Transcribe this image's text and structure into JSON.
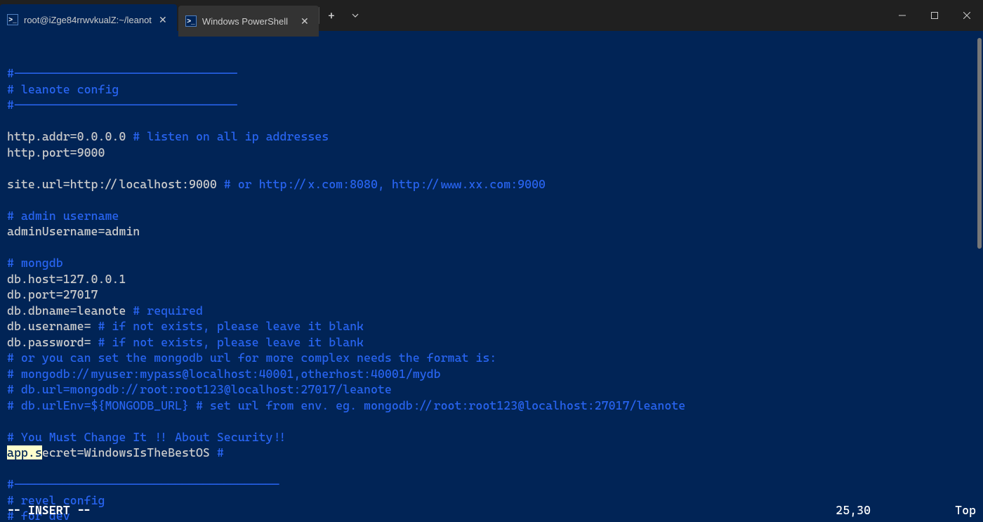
{
  "tabs": [
    {
      "title": "root@iZge84rrwvkualZ:~/leanot",
      "active": true
    },
    {
      "title": "Windows PowerShell",
      "active": false
    }
  ],
  "icons": {
    "ps": ">_",
    "close": "✕",
    "plus": "+",
    "chevron_down": "⌄",
    "minimize": "—",
    "maximize": "▢",
    "window_close": "✕"
  },
  "editor": {
    "lines": [
      {
        "segments": [
          {
            "t": "#--------------------------------",
            "c": "comment"
          }
        ]
      },
      {
        "segments": [
          {
            "t": "# leanote config",
            "c": "comment"
          }
        ]
      },
      {
        "segments": [
          {
            "t": "#--------------------------------",
            "c": "comment"
          }
        ]
      },
      {
        "segments": [
          {
            "t": " ",
            "c": "normal"
          }
        ]
      },
      {
        "segments": [
          {
            "t": "http.addr=0.0.0.0",
            "c": "normal"
          },
          {
            "t": " # listen on all ip addresses",
            "c": "comment"
          }
        ]
      },
      {
        "segments": [
          {
            "t": "http.port=9000",
            "c": "normal"
          }
        ]
      },
      {
        "segments": [
          {
            "t": " ",
            "c": "normal"
          }
        ]
      },
      {
        "segments": [
          {
            "t": "site.url=http://localhost:9000",
            "c": "normal"
          },
          {
            "t": " # or http://x.com:8080, http://www.xx.com:9000",
            "c": "comment"
          }
        ]
      },
      {
        "segments": [
          {
            "t": " ",
            "c": "normal"
          }
        ]
      },
      {
        "segments": [
          {
            "t": "# admin username",
            "c": "comment"
          }
        ]
      },
      {
        "segments": [
          {
            "t": "adminUsername=admin",
            "c": "normal"
          }
        ]
      },
      {
        "segments": [
          {
            "t": " ",
            "c": "normal"
          }
        ]
      },
      {
        "segments": [
          {
            "t": "# mongdb",
            "c": "comment"
          }
        ]
      },
      {
        "segments": [
          {
            "t": "db.host=127.0.0.1",
            "c": "normal"
          }
        ]
      },
      {
        "segments": [
          {
            "t": "db.port=27017",
            "c": "normal"
          }
        ]
      },
      {
        "segments": [
          {
            "t": "db.dbname=leanote",
            "c": "normal"
          },
          {
            "t": " # required",
            "c": "comment"
          }
        ]
      },
      {
        "segments": [
          {
            "t": "db.username=",
            "c": "normal"
          },
          {
            "t": " # if not exists, please leave it blank",
            "c": "comment"
          }
        ]
      },
      {
        "segments": [
          {
            "t": "db.password=",
            "c": "normal"
          },
          {
            "t": " # if not exists, please leave it blank",
            "c": "comment"
          }
        ]
      },
      {
        "segments": [
          {
            "t": "# or you can set the mongodb url for more complex needs the format is:",
            "c": "comment"
          }
        ]
      },
      {
        "segments": [
          {
            "t": "# mongodb://myuser:mypass@localhost:40001,otherhost:40001/mydb",
            "c": "comment"
          }
        ]
      },
      {
        "segments": [
          {
            "t": "# db.url=mongodb://root:root123@localhost:27017/leanote",
            "c": "comment"
          }
        ]
      },
      {
        "segments": [
          {
            "t": "# db.urlEnv=${MONGODB_URL} # set url from env. eg. mongodb://root:root123@localhost:27017/leanote",
            "c": "comment"
          }
        ]
      },
      {
        "segments": [
          {
            "t": " ",
            "c": "normal"
          }
        ]
      },
      {
        "segments": [
          {
            "t": "# You Must Change It !! About Security!!",
            "c": "comment"
          }
        ]
      },
      {
        "segments": [
          {
            "t": "app.s",
            "c": "highlight"
          },
          {
            "t": "ecret=WindowsIsTheBestOS",
            "c": "normal"
          },
          {
            "t": " #",
            "c": "comment"
          }
        ]
      },
      {
        "segments": [
          {
            "t": " ",
            "c": "normal"
          }
        ]
      },
      {
        "segments": [
          {
            "t": "#--------------------------------------",
            "c": "comment"
          }
        ]
      },
      {
        "segments": [
          {
            "t": "# revel config",
            "c": "comment"
          }
        ]
      },
      {
        "segments": [
          {
            "t": "# for dev",
            "c": "comment"
          }
        ]
      }
    ]
  },
  "status": {
    "mode": "-- INSERT --",
    "position": "25,30",
    "scroll": "Top"
  }
}
